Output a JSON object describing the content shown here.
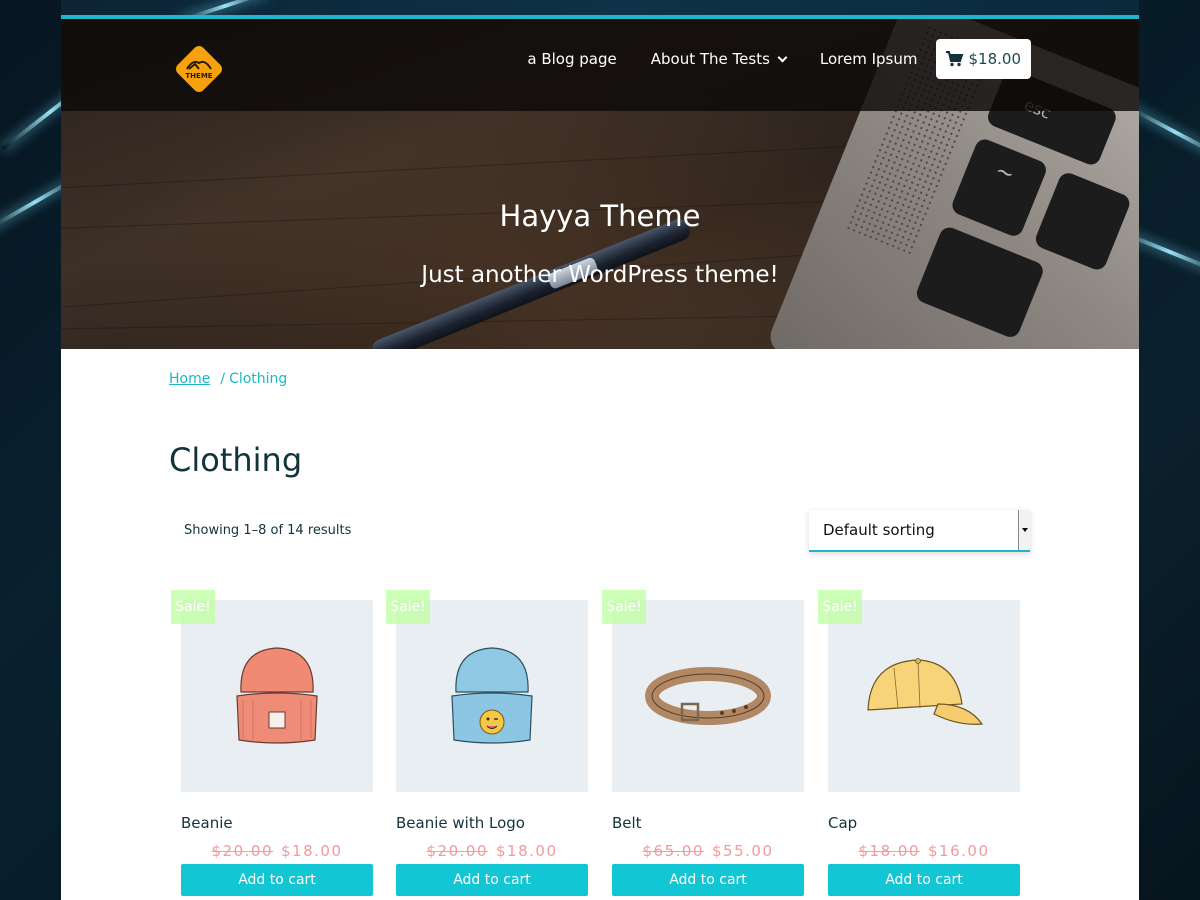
{
  "nav": {
    "items": [
      {
        "label": "a Blog page"
      },
      {
        "label": "About The Tests",
        "has_dropdown": true
      },
      {
        "label": "Lorem Ipsum"
      }
    ],
    "cart_total": "$18.00",
    "cart_icon": "cart-icon",
    "logo_text": "THEME"
  },
  "hero": {
    "title": "Hayya Theme",
    "subtitle": "Just another WordPress theme!",
    "esc_key": "esc",
    "tilde_key": "~"
  },
  "breadcrumb": {
    "home": "Home",
    "separator": "/",
    "current": "Clothing"
  },
  "page_title": "Clothing",
  "result_count": "Showing 1–8 of 14 results",
  "sorting": {
    "selected": "Default sorting"
  },
  "products": [
    {
      "name": "Beanie",
      "old_price": "$20.00",
      "price": "$18.00",
      "sale_badge": "Sale!",
      "button": "Add to cart",
      "icon": "beanie-image"
    },
    {
      "name": "Beanie with Logo",
      "old_price": "$20.00",
      "price": "$18.00",
      "sale_badge": "Sale!",
      "button": "Add to cart",
      "icon": "beanie-logo-image"
    },
    {
      "name": "Belt",
      "old_price": "$65.00",
      "price": "$55.00",
      "sale_badge": "Sale!",
      "button": "Add to cart",
      "icon": "belt-image"
    },
    {
      "name": "Cap",
      "old_price": "$18.00",
      "price": "$16.00",
      "sale_badge": "Sale!",
      "button": "Add to cart",
      "icon": "cap-image"
    }
  ],
  "colors": {
    "accent": "#1fb6c9",
    "button": "#12c6d4",
    "price": "#f49a9a",
    "heading": "#13333a",
    "logo": "#f7a10e"
  }
}
